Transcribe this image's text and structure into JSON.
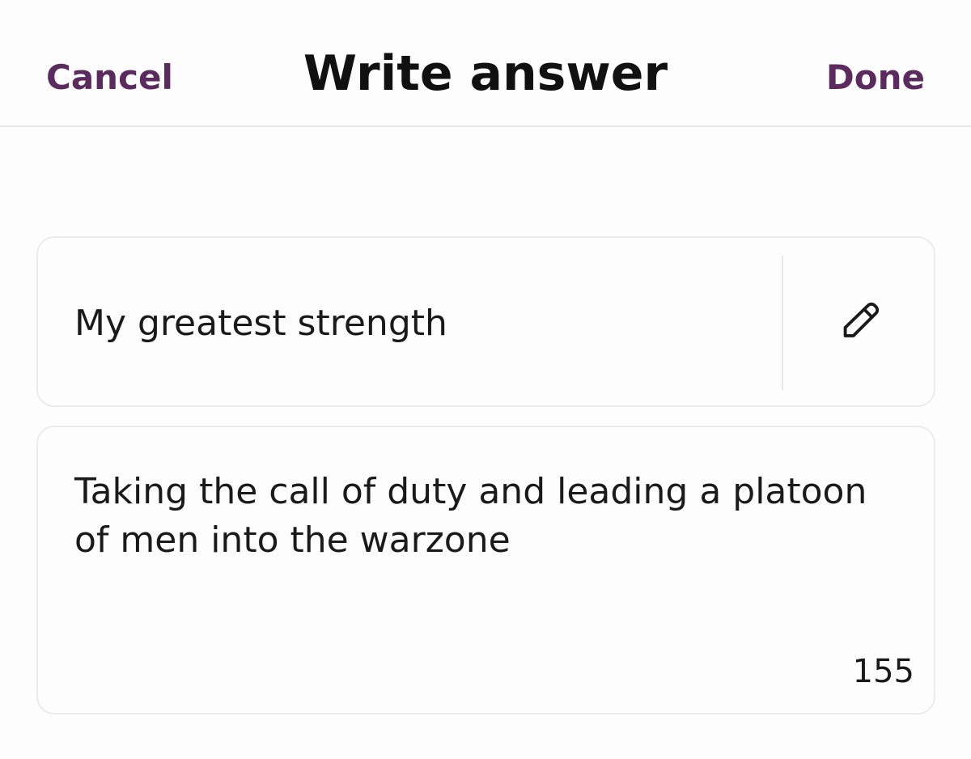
{
  "header": {
    "cancel_label": "Cancel",
    "title": "Write answer",
    "done_label": "Done"
  },
  "prompt": {
    "text": "My greatest strength",
    "edit_icon": "pencil-icon"
  },
  "answer": {
    "text": "Taking the call of duty and leading a platoon\nof men into the warzone",
    "char_count": "155"
  },
  "colors": {
    "accent": "#5b2a5e",
    "text": "#1a1a1a",
    "border": "#ebebeb",
    "background": "#fdfdfd"
  }
}
